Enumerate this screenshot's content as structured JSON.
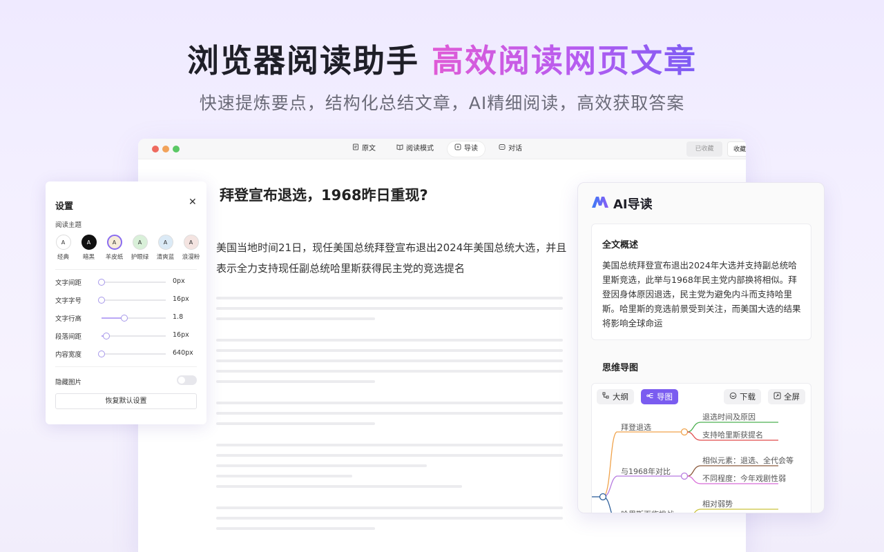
{
  "hero": {
    "title_main": "浏览器阅读助手",
    "title_highlight": "高效阅读网页文章",
    "subtitle": "快速提炼要点，结构化总结文章，AI精细阅读，高效获取答案"
  },
  "browser": {
    "tabs": [
      {
        "label": "原文",
        "icon": "document-icon"
      },
      {
        "label": "阅读模式",
        "icon": "book-icon"
      },
      {
        "label": "导读",
        "icon": "sparkle-icon",
        "active": true
      },
      {
        "label": "对话",
        "icon": "chat-icon"
      }
    ],
    "saved_label": "已收藏",
    "fav_label": "收藏"
  },
  "article": {
    "title": "拜登宣布退选，1968昨日重现?",
    "paragraph": "美国当地时间21日，现任美国总统拜登宣布退出2024年美国总统大选，并且表示全力支持现任副总统哈里斯获得民主党的竞选提名"
  },
  "settings": {
    "title": "设置",
    "theme_label": "阅读主题",
    "themes": [
      {
        "name": "经典",
        "letter": "A",
        "bg": "#ffffff",
        "fg": "#333333"
      },
      {
        "name": "暗黑",
        "letter": "A",
        "bg": "#111111",
        "fg": "#ffffff"
      },
      {
        "name": "羊皮纸",
        "letter": "A",
        "bg": "#f6ecd9",
        "fg": "#333333",
        "selected": true
      },
      {
        "name": "护眼绿",
        "letter": "A",
        "bg": "#d9f0d9",
        "fg": "#333333"
      },
      {
        "name": "清爽蓝",
        "letter": "A",
        "bg": "#dbeaf6",
        "fg": "#333333"
      },
      {
        "name": "浪漫粉",
        "letter": "A",
        "bg": "#f4e4e1",
        "fg": "#333333"
      }
    ],
    "sliders": [
      {
        "label": "文字间距",
        "value": "0px",
        "level": 0.0
      },
      {
        "label": "文字字号",
        "value": "16px",
        "level": 0.0
      },
      {
        "label": "文字行高",
        "value": "1.8",
        "level": 0.35
      },
      {
        "label": "段落间距",
        "value": "16px",
        "level": 0.08
      },
      {
        "label": "内容宽度",
        "value": "640px",
        "level": 0.0
      }
    ],
    "hide_images_label": "隐藏图片",
    "hide_images_on": false,
    "reset_label": "恢复默认设置"
  },
  "ai": {
    "title": "AI导读",
    "summary_heading": "全文概述",
    "summary_body": "美国总统拜登宣布退出2024年大选并支持副总统哈里斯竞选，此举与1968年民主党内部换将相似。拜登因身体原因退选，民主党为避免内斗而支持哈里斯。哈里斯的竞选前景受到关注，而美国大选的结果将影响全球命运",
    "mindmap_heading": "思维导图",
    "chips": {
      "outline": "大纲",
      "mindmap": "导图",
      "download": "下载",
      "fullscreen": "全屏"
    },
    "mindmap": {
      "branches": [
        {
          "label": "拜登退选",
          "color": "#f0a24a",
          "children": [
            {
              "label": "退选时间及原因",
              "color": "#4caf50"
            },
            {
              "label": "支持哈里斯获提名",
              "color": "#e04a4a"
            }
          ]
        },
        {
          "label": "与1968年对比",
          "color": "#b77be0",
          "children": [
            {
              "label": "相似元素：退选、全代会等",
              "color": "#8b5a3c"
            },
            {
              "label": "不同程度：今年戏剧性弱",
              "color": "#d86bd8"
            }
          ]
        },
        {
          "label": "哈里斯面临挑战",
          "color": "#2c5e9a",
          "children": [
            {
              "label": "相对弱势",
              "color": "#c9c23a"
            }
          ]
        }
      ]
    }
  }
}
